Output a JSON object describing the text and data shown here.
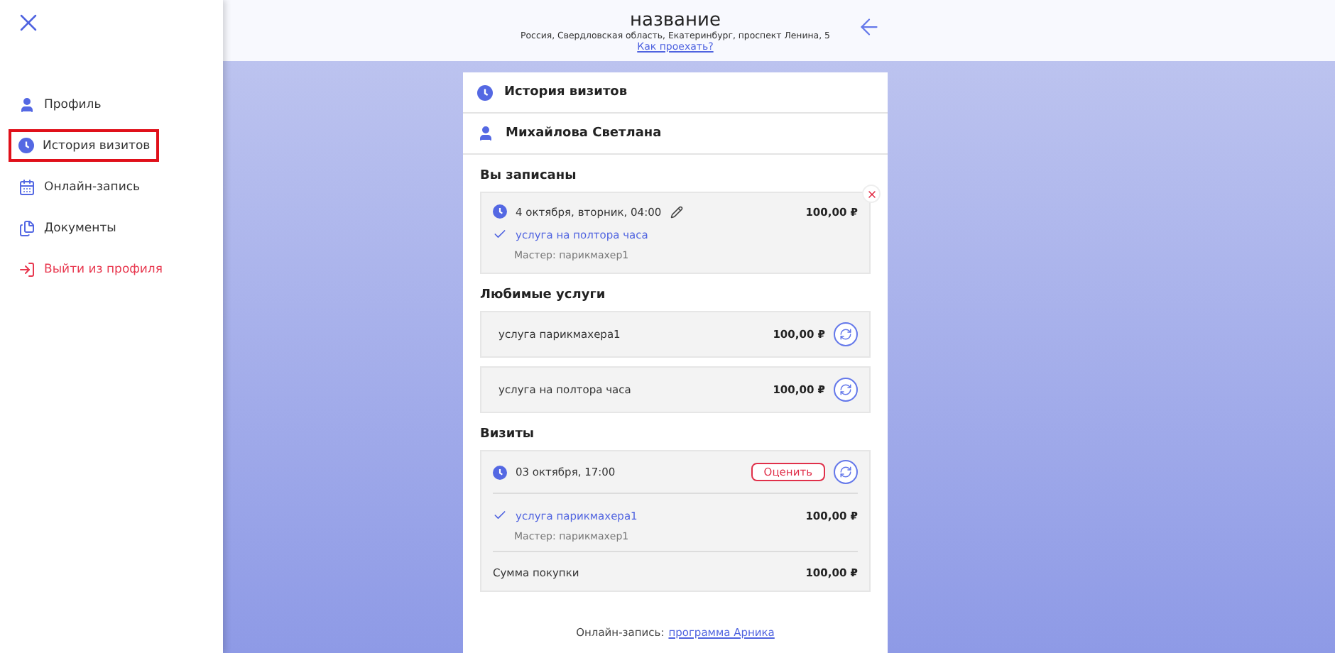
{
  "sidebar": {
    "items": [
      {
        "kind": "profile",
        "label": "Профиль",
        "selected": false
      },
      {
        "kind": "history",
        "label": "История визитов",
        "selected": true
      },
      {
        "kind": "booking",
        "label": "Онлайн-запись",
        "selected": false
      },
      {
        "kind": "documents",
        "label": "Документы",
        "selected": false
      },
      {
        "kind": "logout",
        "label": "Выйти из профиля",
        "selected": false
      }
    ]
  },
  "header": {
    "title": "название",
    "address": "Россия, Свердловская область, Екатеринбург, проспект Ленина, 5",
    "directions_link": "Как проехать?"
  },
  "card": {
    "title": "История визитов",
    "client": "Михайлова Светлана",
    "booked": {
      "title": "Вы записаны",
      "datetime": "4 октября, вторник, 04:00",
      "price": "100,00 ₽",
      "service": "услуга на полтора часа",
      "master": "Мастер: парикмахер1"
    },
    "favorites": {
      "title": "Любимые услуги",
      "items": [
        {
          "name": "услуга парикмахера1",
          "price": "100,00 ₽"
        },
        {
          "name": "услуга на полтора часа",
          "price": "100,00 ₽"
        }
      ]
    },
    "visits": {
      "title": "Визиты",
      "items": [
        {
          "datetime": "03 октября, 17:00",
          "rate_button": "Оценить",
          "service": "услуга парикмахера1",
          "price": "100,00 ₽",
          "master": "Мастер: парикмахер1",
          "total_label": "Сумма покупки",
          "total": "100,00 ₽"
        }
      ]
    },
    "footer": {
      "label": "Онлайн-запись:",
      "link": "программа Арника"
    }
  }
}
